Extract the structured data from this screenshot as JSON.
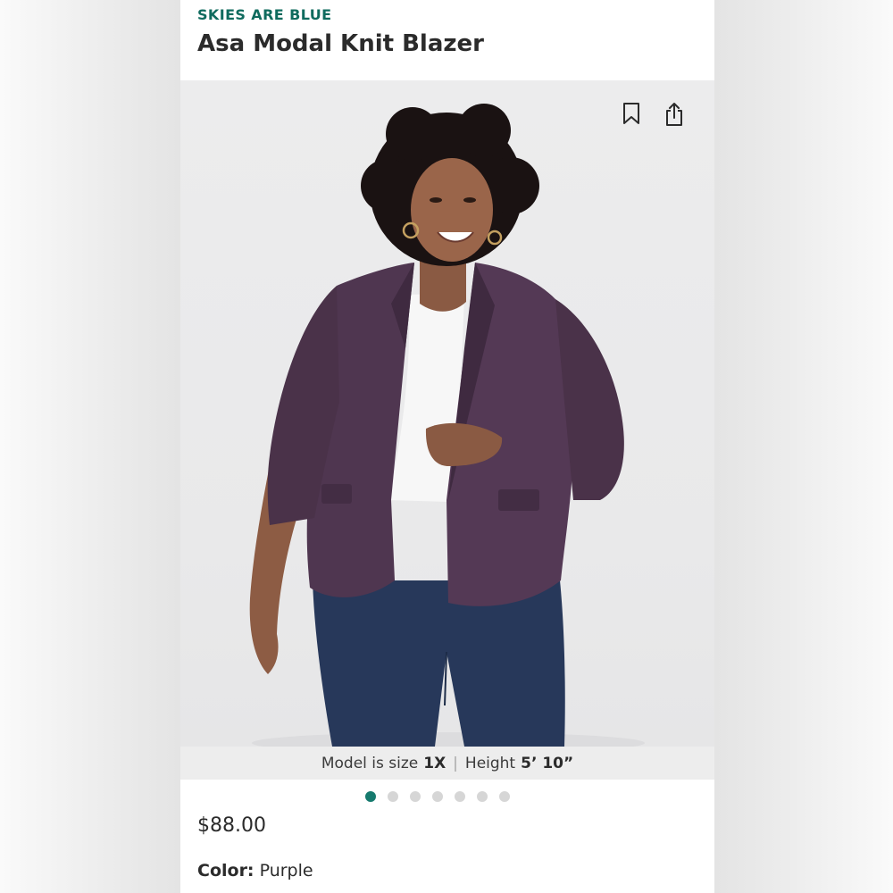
{
  "product": {
    "brand": "SKIES ARE BLUE",
    "title": "Asa Modal Knit Blazer",
    "price": "$88.00",
    "color_label": "Color:",
    "color_value": "Purple"
  },
  "image": {
    "model_size_label": "Model is size",
    "model_size_value": "1X",
    "separator": "|",
    "model_height_label": "Height",
    "model_height_value": "5’ 10”",
    "carousel_count": 7,
    "carousel_active_index": 0
  },
  "icons": {
    "save": "bookmark-icon",
    "share": "share-icon"
  },
  "colors": {
    "brand_accent": "#0f6b5e",
    "active_dot": "#167a6e",
    "blazer": "#4f3650"
  }
}
